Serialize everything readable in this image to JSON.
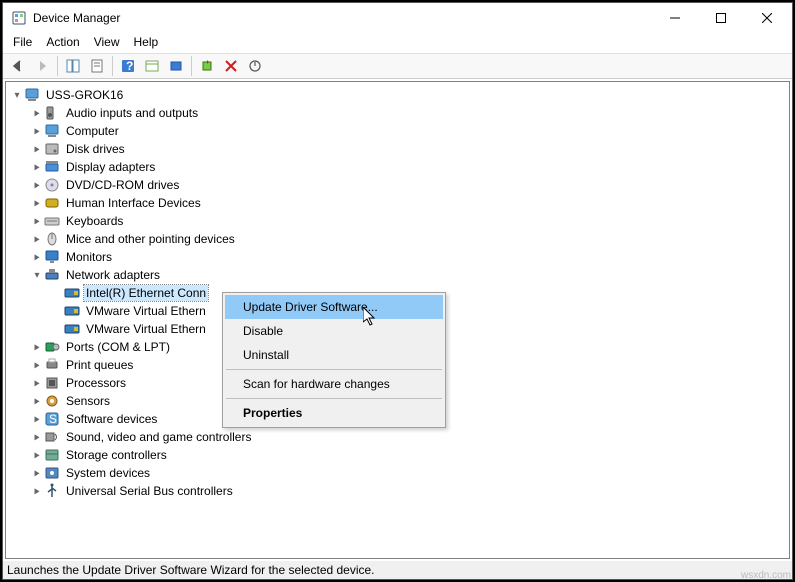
{
  "window": {
    "title": "Device Manager"
  },
  "menubar": [
    "File",
    "Action",
    "View",
    "Help"
  ],
  "tree": {
    "root": "USS-GROK16",
    "categories": [
      {
        "label": "Audio inputs and outputs",
        "expanded": false
      },
      {
        "label": "Computer",
        "expanded": false
      },
      {
        "label": "Disk drives",
        "expanded": false
      },
      {
        "label": "Display adapters",
        "expanded": false
      },
      {
        "label": "DVD/CD-ROM drives",
        "expanded": false
      },
      {
        "label": "Human Interface Devices",
        "expanded": false
      },
      {
        "label": "Keyboards",
        "expanded": false
      },
      {
        "label": "Mice and other pointing devices",
        "expanded": false
      },
      {
        "label": "Monitors",
        "expanded": false
      },
      {
        "label": "Network adapters",
        "expanded": true,
        "children": [
          {
            "label": "Intel(R) Ethernet Conn",
            "selected": true
          },
          {
            "label": "VMware Virtual Ethern"
          },
          {
            "label": "VMware Virtual Ethern"
          }
        ]
      },
      {
        "label": "Ports (COM & LPT)",
        "expanded": false
      },
      {
        "label": "Print queues",
        "expanded": false
      },
      {
        "label": "Processors",
        "expanded": false
      },
      {
        "label": "Sensors",
        "expanded": false
      },
      {
        "label": "Software devices",
        "expanded": false
      },
      {
        "label": "Sound, video and game controllers",
        "expanded": false
      },
      {
        "label": "Storage controllers",
        "expanded": false
      },
      {
        "label": "System devices",
        "expanded": false
      },
      {
        "label": "Universal Serial Bus controllers",
        "expanded": false
      }
    ]
  },
  "context_menu": {
    "items": [
      {
        "label": "Update Driver Software...",
        "hl": true
      },
      {
        "label": "Disable"
      },
      {
        "label": "Uninstall"
      },
      {
        "sep": true
      },
      {
        "label": "Scan for hardware changes"
      },
      {
        "sep": true
      },
      {
        "label": "Properties",
        "bold": true
      }
    ]
  },
  "statusbar": "Launches the Update Driver Software Wizard for the selected device.",
  "watermark": "wsxdn.com",
  "icons": {
    "categories": {
      "Audio inputs and outputs": "speaker",
      "Computer": "computer",
      "Disk drives": "disk",
      "Display adapters": "display",
      "DVD/CD-ROM drives": "dvd",
      "Human Interface Devices": "hid",
      "Keyboards": "keyboard",
      "Mice and other pointing devices": "mouse",
      "Monitors": "monitor",
      "Network adapters": "network",
      "Ports (COM & LPT)": "port",
      "Print queues": "printer",
      "Processors": "cpu",
      "Sensors": "sensor",
      "Software devices": "software",
      "Sound, video and game controllers": "sound",
      "Storage controllers": "storage",
      "System devices": "system",
      "Universal Serial Bus controllers": "usb"
    }
  }
}
